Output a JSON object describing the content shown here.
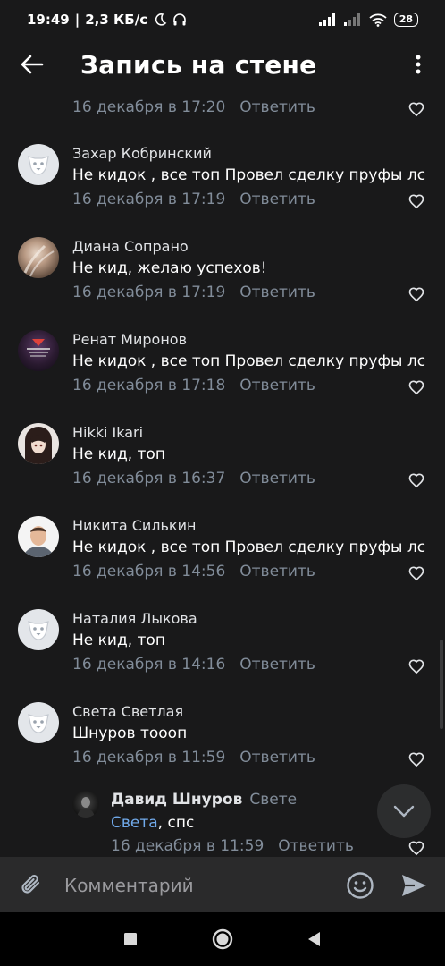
{
  "status_bar": {
    "time": "19:49",
    "speed": "2,3 КБ/с",
    "battery": "28"
  },
  "header": {
    "title": "Запись на стене"
  },
  "first_comment": {
    "date": "16 декабря в 17:20",
    "reply": "Ответить"
  },
  "comments": [
    {
      "name": "Захар Кобринский",
      "text": "Не кидок , все топ Провел сделку пруфы лс",
      "date": "16 декабря в 17:19",
      "reply": "Ответить",
      "avatar": "default"
    },
    {
      "name": "Диана Сопрано",
      "text": "Не кид, желаю успехов!",
      "date": "16 декабря в 17:19",
      "reply": "Ответить",
      "avatar": "photo"
    },
    {
      "name": "Ренат Миронов",
      "text": "Не кидок , все топ Провел сделку пруфы лс",
      "date": "16 декабря в 17:18",
      "reply": "Ответить",
      "avatar": "photo"
    },
    {
      "name": "Hikki Ikari",
      "text": "Не кид, топ",
      "date": "16 декабря в 16:37",
      "reply": "Ответить",
      "avatar": "photo"
    },
    {
      "name": "Никита Силькин",
      "text": "Не кидок , все топ Провел сделку пруфы лс",
      "date": "16 декабря в 14:56",
      "reply": "Ответить",
      "avatar": "photo"
    },
    {
      "name": "Наталия Лыкова",
      "text": "Не кид, топ",
      "date": "16 декабря в 14:16",
      "reply": "Ответить",
      "avatar": "default"
    },
    {
      "name": "Света Светлая",
      "text": "Шнуров тоооп",
      "date": "16 декабря в 11:59",
      "reply": "Ответить",
      "avatar": "default"
    }
  ],
  "sub_comment": {
    "name": "Давид Шнуров",
    "to": "Свете",
    "mention": "Света",
    "text": ", спс",
    "date": "16 декабря в 11:59",
    "reply": "Ответить"
  },
  "composer": {
    "placeholder": "Комментарий"
  },
  "icons": {
    "back": "arrow-left-icon",
    "menu": "more-vertical-icon",
    "like": "heart-outline-icon",
    "scroll_down": "chevron-down-icon",
    "attach": "paperclip-icon",
    "emoji": "smile-icon",
    "send": "send-icon"
  },
  "colors": {
    "background": "#19191a",
    "text": "#e1e3e6",
    "secondary": "#818c99",
    "link": "#71aaeb",
    "composer": "#2a2a2b"
  }
}
